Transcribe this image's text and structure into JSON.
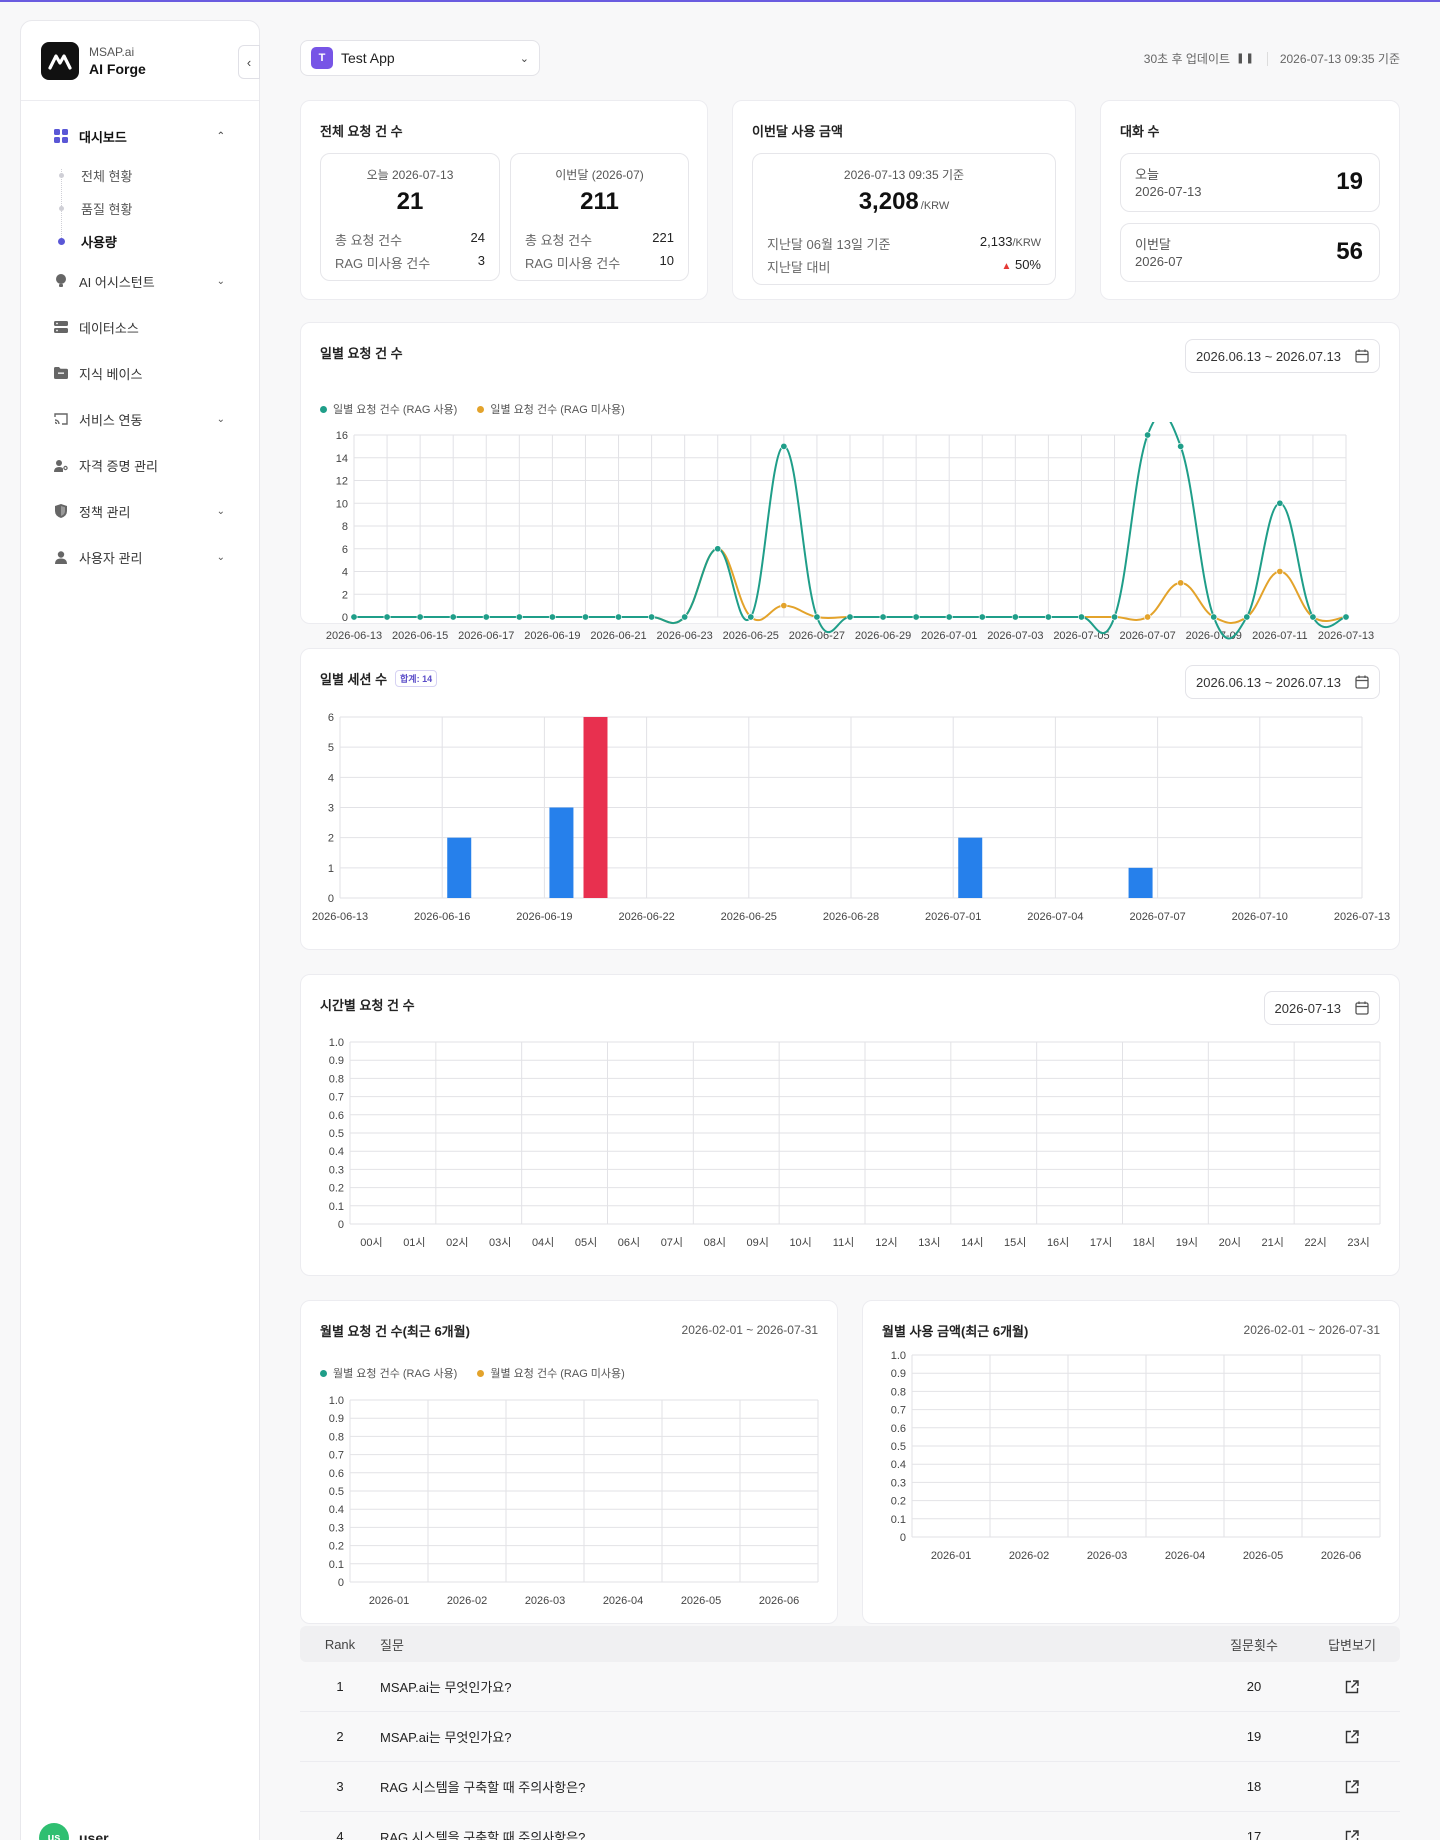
{
  "brand": {
    "small": "MSAP.ai",
    "name": "AI Forge"
  },
  "sidebar": {
    "items": [
      {
        "label": "대시보드",
        "icon": "grid-icon",
        "active": true,
        "children": [
          {
            "label": "전체 현황",
            "active": false
          },
          {
            "label": "품질 현황",
            "active": false
          },
          {
            "label": "사용량",
            "active": true
          }
        ]
      },
      {
        "label": "AI 어시스턴트",
        "icon": "bulb-icon",
        "expandable": true
      },
      {
        "label": "데이터소스",
        "icon": "server-icon"
      },
      {
        "label": "지식 베이스",
        "icon": "folder-icon"
      },
      {
        "label": "서비스 연동",
        "icon": "cast-icon",
        "expandable": true
      },
      {
        "label": "자격 증명 관리",
        "icon": "user-key-icon"
      },
      {
        "label": "정책 관리",
        "icon": "shield-icon",
        "expandable": true
      },
      {
        "label": "사용자 관리",
        "icon": "user-icon",
        "expandable": true
      }
    ],
    "user": {
      "initials": "us",
      "name": "user"
    }
  },
  "topbar": {
    "app_badge": "T",
    "app_name": "Test App",
    "update_text": "30초 후 업데이트",
    "timestamp": "2026-07-13 09:35 기준"
  },
  "requests_card": {
    "title": "전체 요청 건 수",
    "today": {
      "caption": "오늘 2026-07-13",
      "value": "21",
      "total_label": "총 요청 건수",
      "total": "24",
      "norag_label": "RAG 미사용 건수",
      "norag": "3"
    },
    "month": {
      "caption": "이번달 (2026-07)",
      "value": "211",
      "total_label": "총 요청 건수",
      "total": "221",
      "norag_label": "RAG 미사용 건수",
      "norag": "10"
    }
  },
  "cost_card": {
    "title": "이번달 사용 금액",
    "caption": "2026-07-13 09:35 기준",
    "value": "3,208",
    "unit": "/KRW",
    "prev_label": "지난달 06월 13일 기준",
    "prev_value": "2,133",
    "prev_unit": "/KRW",
    "diff_label": "지난달 대비",
    "diff_value": "50%"
  },
  "conv_card": {
    "title": "대화 수",
    "today_label": "오늘",
    "today_date": "2026-07-13",
    "today_value": "19",
    "month_label": "이번달",
    "month_date": "2026-07",
    "month_value": "56"
  },
  "daily_requests": {
    "title": "일별 요청 건 수",
    "range": "2026.06.13 ~ 2026.07.13"
  },
  "daily_sessions": {
    "title": "일별 세션 수",
    "total_tag": "합계: 14",
    "range": "2026.06.13 ~ 2026.07.13"
  },
  "hourly": {
    "title": "시간별 요청 건 수",
    "date": "2026-07-13"
  },
  "monthly_requests": {
    "title": "월별 요청 건 수(최근 6개월)",
    "range": "2026-02-01 ~ 2026-07-31"
  },
  "monthly_cost": {
    "title": "월별 사용 금액(최근 6개월)",
    "range": "2026-02-01 ~ 2026-07-31"
  },
  "colors": {
    "rag": "#1f9e89",
    "norag": "#e3a32b",
    "bar_blue": "#2680eb",
    "bar_red": "#e8304f",
    "accent": "#6a5ce0"
  },
  "chart_data": [
    {
      "type": "line",
      "title": "일별 요청 건 수",
      "x": [
        "2026-06-13",
        "2026-06-14",
        "2026-06-15",
        "2026-06-16",
        "2026-06-17",
        "2026-06-18",
        "2026-06-19",
        "2026-06-20",
        "2026-06-21",
        "2026-06-22",
        "2026-06-23",
        "2026-06-24",
        "2026-06-25",
        "2026-06-26",
        "2026-06-27",
        "2026-06-28",
        "2026-06-29",
        "2026-06-30",
        "2026-07-01",
        "2026-07-02",
        "2026-07-03",
        "2026-07-04",
        "2026-07-05",
        "2026-07-06",
        "2026-07-07",
        "2026-07-08",
        "2026-07-09",
        "2026-07-10",
        "2026-07-11",
        "2026-07-12",
        "2026-07-13"
      ],
      "xticks": [
        "2026-06-13",
        "2026-06-15",
        "2026-06-17",
        "2026-06-19",
        "2026-06-21",
        "2026-06-23",
        "2026-06-25",
        "2026-06-27",
        "2026-06-29",
        "2026-07-01",
        "2026-07-03",
        "2026-07-05",
        "2026-07-07",
        "2026-07-09",
        "2026-07-11",
        "2026-07-13"
      ],
      "series": [
        {
          "name": "일별 요청 건수 (RAG 사용)",
          "values": [
            0,
            0,
            0,
            0,
            0,
            0,
            0,
            0,
            0,
            0,
            0,
            6,
            0,
            15,
            0,
            0,
            0,
            0,
            0,
            0,
            0,
            0,
            0,
            0,
            16,
            15,
            0,
            0,
            10,
            0,
            0
          ]
        },
        {
          "name": "일별 요청 건수 (RAG 미사용)",
          "values": [
            0,
            0,
            0,
            0,
            0,
            0,
            0,
            0,
            0,
            0,
            0,
            6,
            0,
            1,
            0,
            0,
            0,
            0,
            0,
            0,
            0,
            0,
            0,
            0,
            0,
            3,
            0,
            0,
            4,
            0,
            0
          ]
        }
      ],
      "ylim": [
        0,
        16
      ],
      "yticks": [
        0,
        2,
        4,
        6,
        8,
        10,
        12,
        14,
        16
      ],
      "legend": "top-left",
      "grid": true
    },
    {
      "type": "bar",
      "title": "일별 세션 수",
      "categories": [
        "2026-06-13",
        "2026-06-16",
        "2026-06-19",
        "2026-06-22",
        "2026-06-25",
        "2026-06-28",
        "2026-07-01",
        "2026-07-04",
        "2026-07-07",
        "2026-07-10",
        "2026-07-13"
      ],
      "bars": [
        {
          "date": "2026-06-16",
          "value": 2,
          "color": "blue"
        },
        {
          "date": "2026-06-19",
          "value": 3,
          "color": "blue"
        },
        {
          "date": "2026-06-20",
          "value": 6,
          "color": "red"
        },
        {
          "date": "2026-07-01",
          "value": 2,
          "color": "blue"
        },
        {
          "date": "2026-07-06",
          "value": 1,
          "color": "blue"
        }
      ],
      "ylim": [
        0,
        6
      ],
      "yticks": [
        0,
        1,
        2,
        3,
        4,
        5,
        6
      ],
      "grid": true
    },
    {
      "type": "line",
      "title": "시간별 요청 건 수",
      "categories": [
        "00시",
        "01시",
        "02시",
        "03시",
        "04시",
        "05시",
        "06시",
        "07시",
        "08시",
        "09시",
        "10시",
        "11시",
        "12시",
        "13시",
        "14시",
        "15시",
        "16시",
        "17시",
        "18시",
        "19시",
        "20시",
        "21시",
        "22시",
        "23시"
      ],
      "values": [],
      "ylim": [
        0,
        1
      ],
      "yticks": [
        "0",
        "0.1",
        "0.2",
        "0.3",
        "0.4",
        "0.5",
        "0.6",
        "0.7",
        "0.8",
        "0.9",
        "1.0"
      ],
      "grid": true
    },
    {
      "type": "bar",
      "title": "월별 요청 건 수(최근 6개월)",
      "categories": [
        "2026-01",
        "2026-02",
        "2026-03",
        "2026-04",
        "2026-05",
        "2026-06"
      ],
      "series": [
        {
          "name": "월별 요청 건수 (RAG 사용)",
          "values": []
        },
        {
          "name": "월별 요청 건수 (RAG 미사용)",
          "values": []
        }
      ],
      "ylim": [
        0,
        1
      ],
      "yticks": [
        "0",
        "0.1",
        "0.2",
        "0.3",
        "0.4",
        "0.5",
        "0.6",
        "0.7",
        "0.8",
        "0.9",
        "1.0"
      ],
      "legend": "top-left",
      "grid": true
    },
    {
      "type": "bar",
      "title": "월별 사용 금액(최근 6개월)",
      "categories": [
        "2026-01",
        "2026-02",
        "2026-03",
        "2026-04",
        "2026-05",
        "2026-06"
      ],
      "values": [],
      "ylim": [
        0,
        1
      ],
      "yticks": [
        "0",
        "0.1",
        "0.2",
        "0.3",
        "0.4",
        "0.5",
        "0.6",
        "0.7",
        "0.8",
        "0.9",
        "1.0"
      ],
      "grid": true
    }
  ],
  "table": {
    "headers": {
      "rank": "Rank",
      "question": "질문",
      "count": "질문횟수",
      "answer": "답변보기"
    },
    "rows": [
      {
        "rank": "1",
        "question": "MSAP.ai는 무엇인가요?",
        "count": "20"
      },
      {
        "rank": "2",
        "question": "MSAP.ai는 무엇인가요?",
        "count": "19"
      },
      {
        "rank": "3",
        "question": "RAG 시스템을 구축할 때 주의사항은?",
        "count": "18"
      },
      {
        "rank": "4",
        "question": "RAG 시스템을 구축할 때 주의사항은?",
        "count": "17"
      }
    ]
  }
}
